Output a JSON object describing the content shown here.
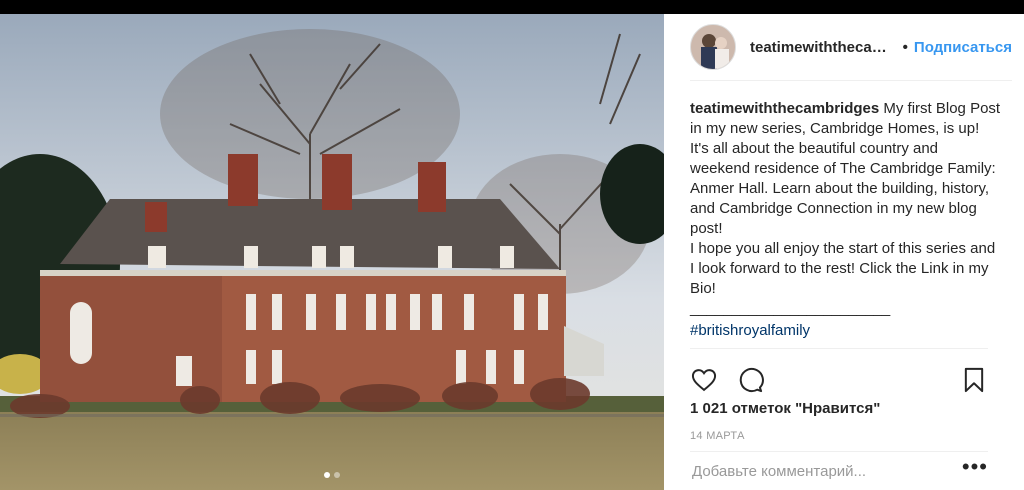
{
  "post": {
    "username": "teatimewiththecam...",
    "separator": "•",
    "follow_label": "Подписаться",
    "caption_user": "teatimewiththecambridges",
    "caption_text": " My first Blog Post in my new series, Cambridge Homes, is up! It's all about the beautiful country and weekend residence of The Cambridge Family: Anmer Hall. Learn about the building, history, and Cambridge Connection in my new blog post!\nI hope you all enjoy the start of this series and I look forward to the rest! Click the Link in my Bio!",
    "divider": "________________________",
    "hashtag": "#britishroyalfamily",
    "likes": "1 021 отметок \"Нравится\"",
    "date": "14 МАРТА",
    "comment_placeholder": "Добавьте комментарий...",
    "more_label": "•••",
    "carousel": {
      "count": 2,
      "active": 1
    }
  },
  "icons": {
    "like": "heart-icon",
    "comment": "comment-icon",
    "save": "bookmark-icon",
    "more": "more-options-icon"
  },
  "colors": {
    "link": "#3897f0",
    "hashtag": "#003569",
    "text": "#262626",
    "muted": "#999999"
  }
}
